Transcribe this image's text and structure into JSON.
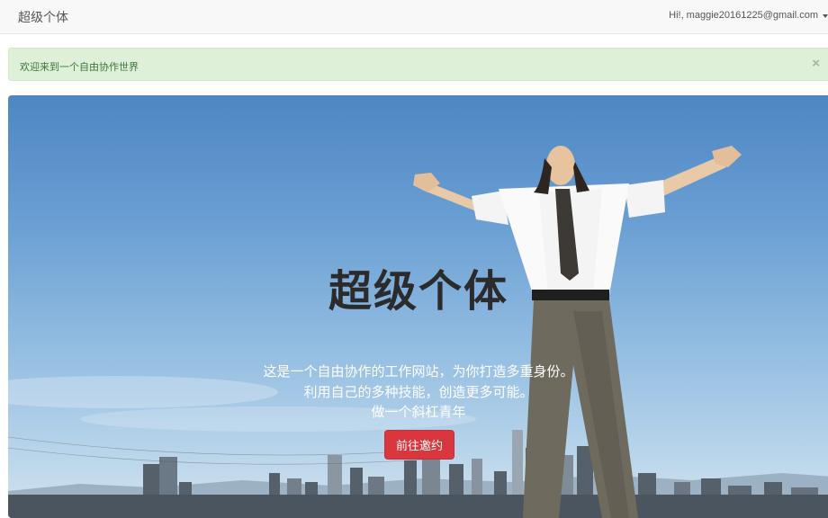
{
  "navbar": {
    "brand": "超级个体",
    "user_menu": "Hi!, maggie20161225@gmail.com"
  },
  "alert": {
    "message": "欢迎来到一个自由协作世界",
    "close": "×"
  },
  "hero": {
    "title": "超级个体",
    "lines": [
      "这是一个自由协作的工作网站，为你打造多重身份。",
      "利用自己的多种技能，创造更多可能。",
      "做一个斜杠青年"
    ],
    "cta_label": "前往邀约"
  },
  "colors": {
    "alert_bg": "#dff0d8",
    "alert_text": "#3c763d",
    "cta": "#d9363e"
  },
  "icons": [
    "caret-down-icon",
    "close-icon"
  ]
}
